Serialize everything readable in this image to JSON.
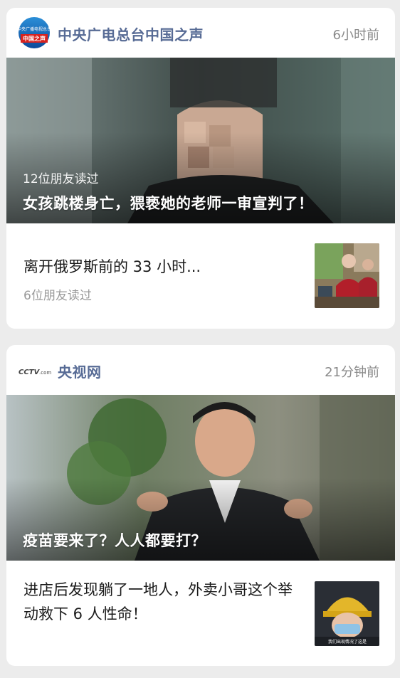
{
  "cards": [
    {
      "source": {
        "name": "中央广电总台中国之声",
        "time": "6小时前",
        "logo_text_top": "中央广播电视总台",
        "logo_text_bottom": "中国之声"
      },
      "hero": {
        "readers": "12位朋友读过",
        "title": "女孩跳楼身亡，猥亵她的老师一审宣判了！"
      },
      "sub": {
        "title": "离开俄罗斯前的 33 小时...",
        "readers": "6位朋友读过"
      }
    },
    {
      "source": {
        "name": "央视网",
        "time": "21分钟前",
        "logo_text": "CCTV",
        "logo_suffix": ".com"
      },
      "hero": {
        "title": "疫苗要来了？人人都要打？"
      },
      "sub": {
        "title": "进店后发现躺了一地人，外卖小哥这个举动救下 6 人性命！",
        "thumb_caption": "我们出现情况了这是"
      }
    }
  ]
}
